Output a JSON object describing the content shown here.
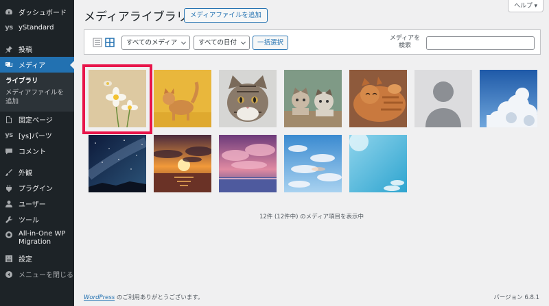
{
  "sidebar": {
    "items": [
      {
        "label": "ダッシュボード",
        "icon": "dashboard-icon"
      },
      {
        "label": "yStandard",
        "icon": "ys-icon"
      },
      {
        "label": "投稿",
        "icon": "pin-icon"
      },
      {
        "label": "メディア",
        "icon": "media-icon"
      },
      {
        "label": "固定ページ",
        "icon": "page-icon"
      },
      {
        "label": "[ys]パーツ",
        "icon": "ys-icon"
      },
      {
        "label": "コメント",
        "icon": "comment-icon"
      },
      {
        "label": "外観",
        "icon": "brush-icon"
      },
      {
        "label": "プラグイン",
        "icon": "plugin-icon"
      },
      {
        "label": "ユーザー",
        "icon": "user-icon"
      },
      {
        "label": "ツール",
        "icon": "wrench-icon"
      },
      {
        "label": "All-in-One WP Migration",
        "icon": "migration-icon"
      },
      {
        "label": "設定",
        "icon": "settings-icon"
      },
      {
        "label": "メニューを閉じる",
        "icon": "collapse-icon"
      }
    ],
    "ys_mark": "ys",
    "submenu": [
      {
        "label": "ライブラリ"
      },
      {
        "label": "メディアファイルを追加"
      }
    ]
  },
  "header": {
    "title": "メディアライブラリ",
    "add_button": "メディアファイルを追加",
    "help": "ヘルプ ▾"
  },
  "toolbar": {
    "media_filter": "すべてのメディア",
    "date_filter": "すべての日付",
    "bulk_select": "一括選択",
    "search_label": "メディアを検索",
    "search_value": ""
  },
  "grid": {
    "items": [
      {
        "name": "flowers-image",
        "selected": true
      },
      {
        "name": "cat-yellow-image"
      },
      {
        "name": "tabby-cat-image"
      },
      {
        "name": "two-cats-image"
      },
      {
        "name": "cat-lying-image"
      },
      {
        "name": "placeholder-person-image"
      },
      {
        "name": "sky-clouds-image"
      },
      {
        "name": "night-sky-image"
      },
      {
        "name": "sunset-sea-image"
      },
      {
        "name": "purple-clouds-image"
      },
      {
        "name": "blue-sky-clouds-image"
      },
      {
        "name": "clear-sky-image"
      }
    ]
  },
  "status": {
    "count_text": "12件 (12件中) のメディア項目を表示中"
  },
  "footer": {
    "link_text": "WordPress",
    "text": " のご利用ありがとうございます。",
    "version": "バージョン 6.8.1"
  },
  "colors": {
    "accent": "#2271b1",
    "sidebar_bg": "#1d2327",
    "highlight": "#e8154a"
  }
}
